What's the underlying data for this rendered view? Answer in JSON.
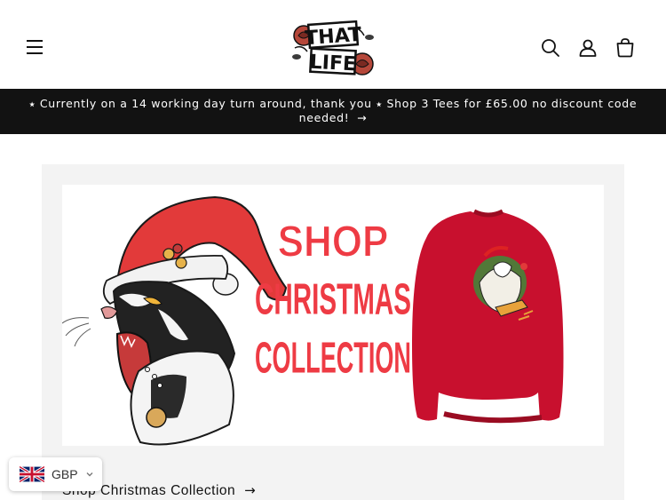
{
  "header": {
    "logo_text_line1": "THAT",
    "logo_text_line2": "LIFE",
    "icons": [
      "menu-icon",
      "search-icon",
      "account-icon",
      "cart-icon"
    ]
  },
  "announcement": {
    "text": "⭑ Currently on a 14 working day turn around, thank you ⭑ Shop 3 Tees for £65.00 no discount code needed!",
    "arrow": "→"
  },
  "banner": {
    "headline_line1": "SHOP",
    "headline_line2": "CHRISTMAS",
    "headline_line3": "COLLECTION",
    "headline_color": "#ee3b44"
  },
  "collection_link": {
    "label": "Shop Christmas Collection",
    "arrow": "→"
  },
  "currency": {
    "code": "GBP",
    "flag": "uk-flag-icon"
  },
  "colors": {
    "announcement_bg": "#121212",
    "card_bg": "#f3f3f3",
    "sweater_red": "#c8102e"
  }
}
